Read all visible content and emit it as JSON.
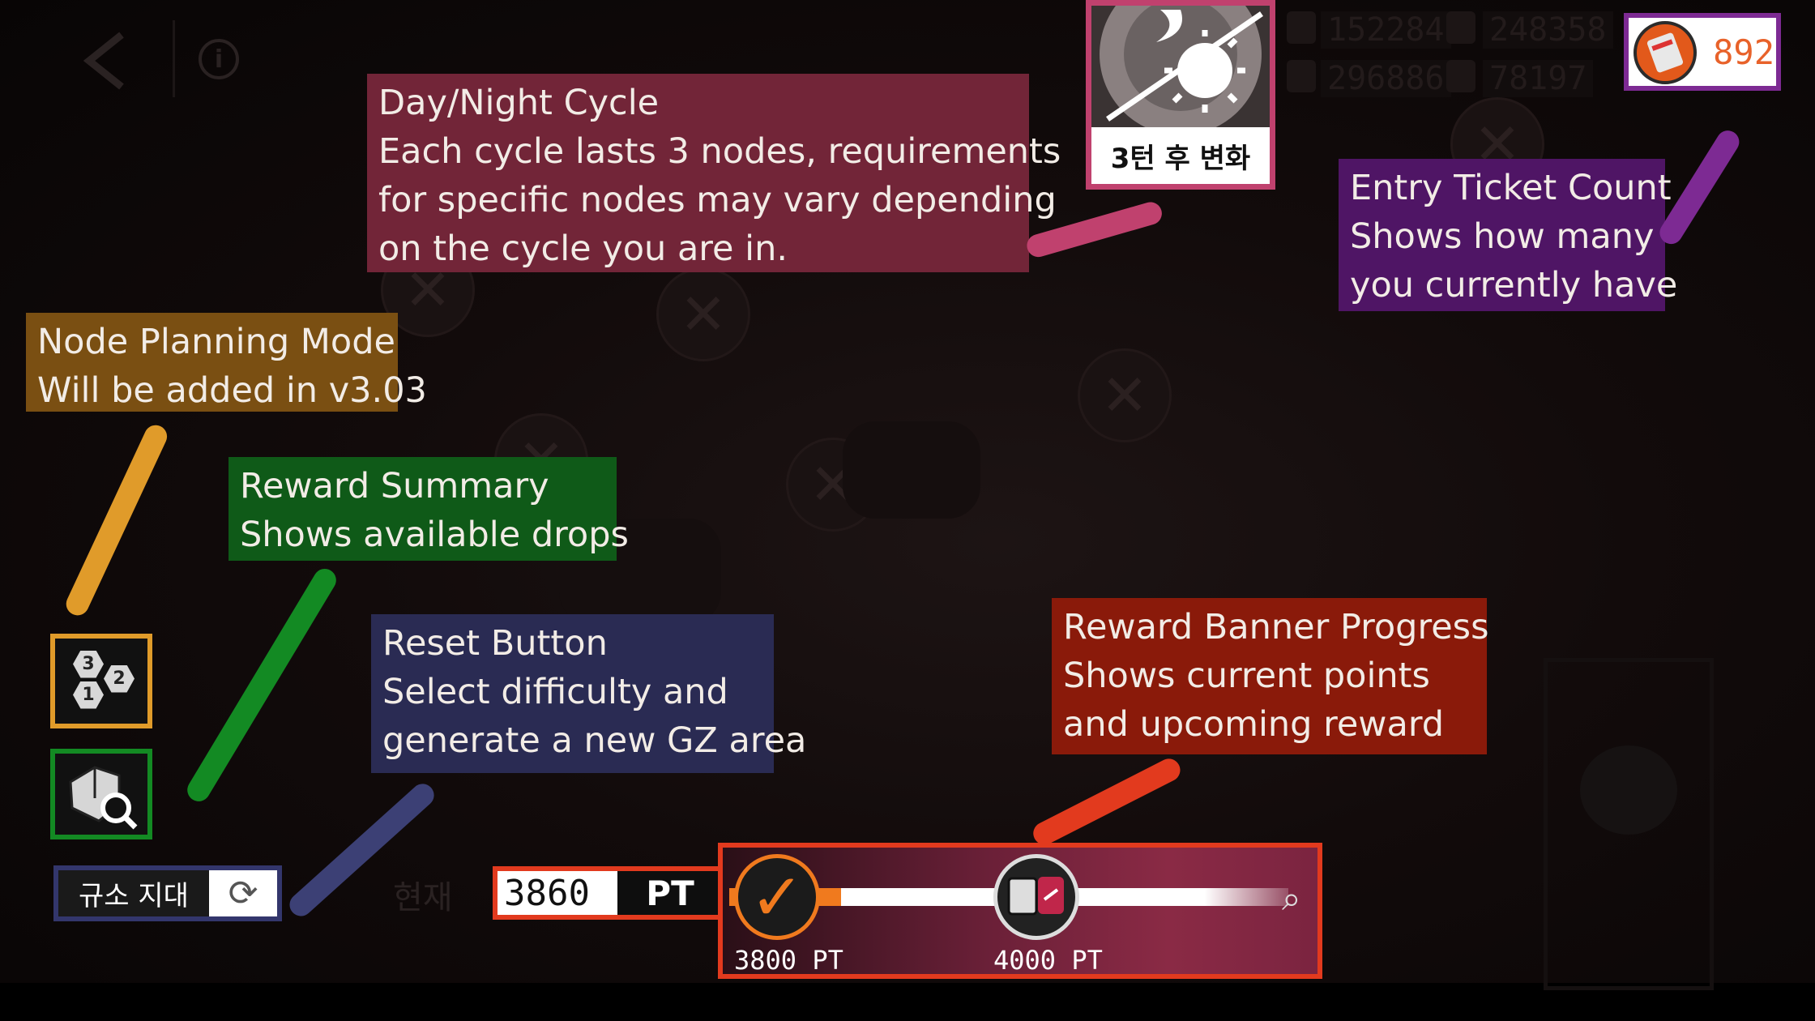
{
  "top_bar": {
    "back_icon": "chevron-left-icon",
    "info_icon": "info-icon",
    "resources": [
      "152284",
      "248358",
      "296886",
      "78197"
    ]
  },
  "day_night": {
    "label": "3턴 후 변화",
    "icon": "sun-moon-icon"
  },
  "ticket": {
    "value": "892",
    "icon": "ticket-icon"
  },
  "callouts": {
    "day_night": {
      "title": "Day/Night Cycle",
      "lines": [
        "Each cycle lasts 3 nodes, requirements",
        "for specific nodes may vary depending",
        "on the cycle you are in."
      ]
    },
    "ticket": {
      "title": "Entry Ticket Count",
      "lines": [
        "Shows how many",
        "you currently have"
      ]
    },
    "planning": {
      "title": "Node Planning Mode",
      "lines": [
        "Will be added in v3.03"
      ]
    },
    "reward": {
      "title": "Reward Summary",
      "lines": [
        "Shows available drops"
      ]
    },
    "reset": {
      "title": "Reset Button",
      "lines": [
        "Select difficulty and",
        "generate a new GZ area"
      ]
    },
    "banner": {
      "title": "Reward Banner Progress",
      "lines": [
        "Shows current points",
        "and upcoming reward"
      ]
    }
  },
  "side_buttons": {
    "planning_numbers": [
      "3",
      "2",
      "1"
    ],
    "reset_label": "규소 지대"
  },
  "points": {
    "current_label": "현재",
    "value": "3860",
    "unit": "PT"
  },
  "banner": {
    "progress_fraction": 0.2,
    "milestones": [
      {
        "label": "3800 PT",
        "claimed": true
      },
      {
        "label": "4000 PT",
        "claimed": false
      }
    ]
  },
  "colors": {
    "day_night": "#722538",
    "ticket": "#4f1565",
    "planning": "#7a4f12",
    "reward": "#0f5a18",
    "reset": "#2a2b53",
    "banner": "#8a1a0a",
    "accent": "#e23a1e"
  }
}
